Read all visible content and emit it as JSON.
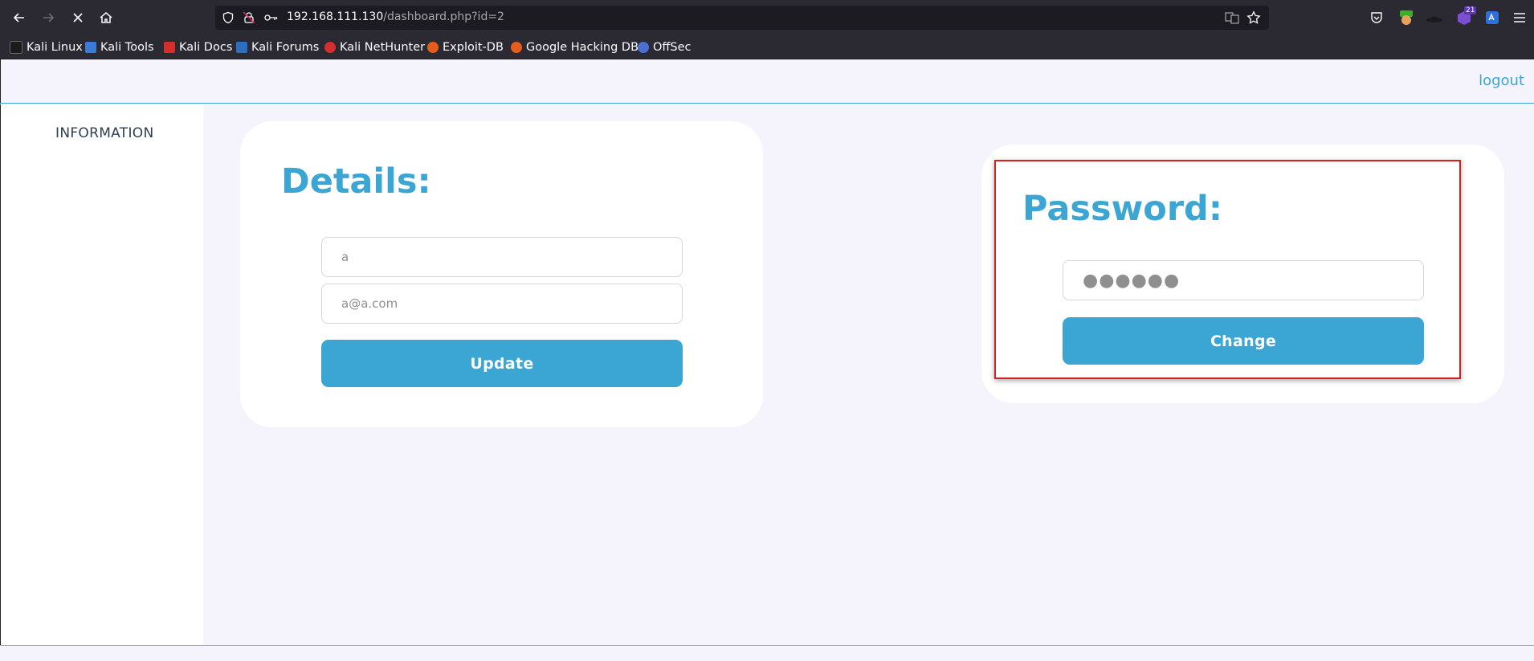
{
  "browser": {
    "url_host": "192.168.111.130",
    "url_path": "/dashboard.php?id=2",
    "badge_count": "21",
    "bookmarks": [
      {
        "label": "Kali Linux",
        "color": "#1b1b1b"
      },
      {
        "label": "Kali Tools",
        "color": "#3a7bd5"
      },
      {
        "label": "Kali Docs",
        "color": "#d32f2f"
      },
      {
        "label": "Kali Forums",
        "color": "#2d6fbe"
      },
      {
        "label": "Kali NetHunter",
        "color": "#d32f2f"
      },
      {
        "label": "Exploit-DB",
        "color": "#e65c1a"
      },
      {
        "label": "Google Hacking DB",
        "color": "#e65c1a"
      },
      {
        "label": "OffSec",
        "color": "#4b6fcf"
      }
    ]
  },
  "header": {
    "logout_label": "logout"
  },
  "sidebar": {
    "item_label": "INFORMATION"
  },
  "details": {
    "title": "Details:",
    "name_placeholder": "a",
    "email_placeholder": "a@a.com",
    "update_label": "Update"
  },
  "password": {
    "title": "Password:",
    "masked_value": "●●●●●●",
    "change_label": "Change"
  },
  "colors": {
    "accent": "#3ba6d4",
    "highlight": "#d62020",
    "page_bg": "#f5f4fc"
  }
}
